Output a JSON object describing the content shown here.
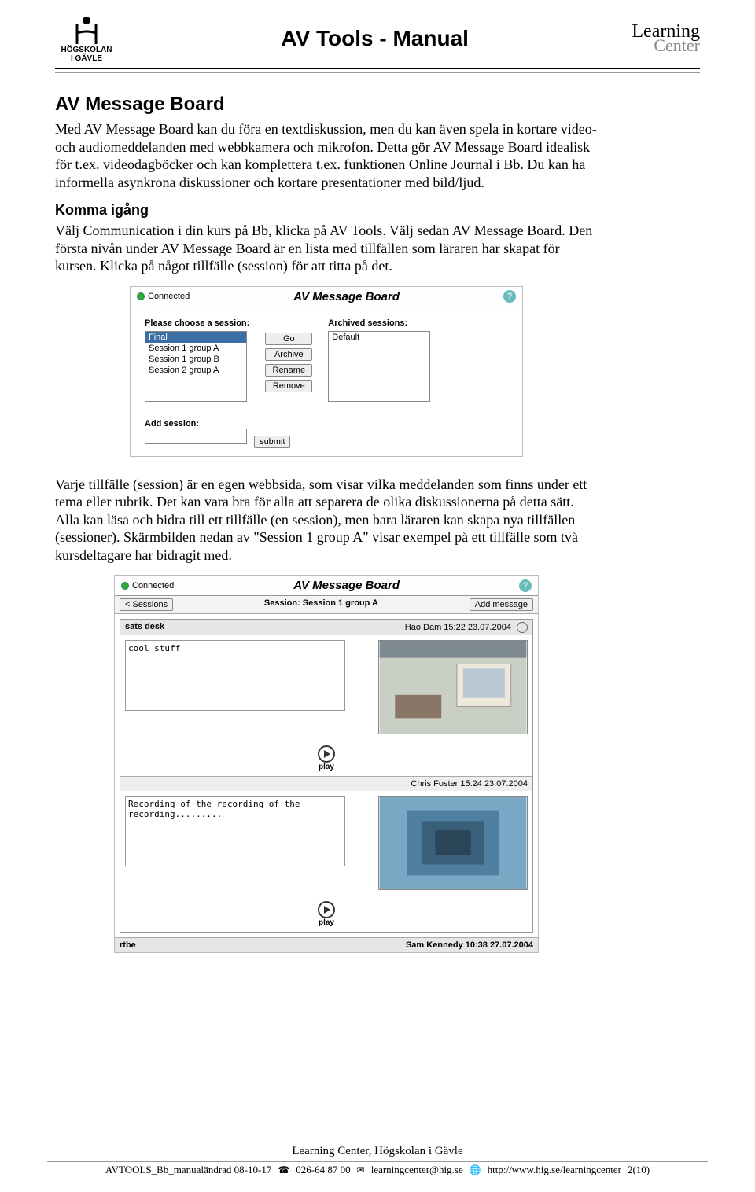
{
  "header": {
    "logo_line1": "HÖGSKOLAN",
    "logo_line2": "I GÄVLE",
    "title": "AV Tools - Manual",
    "right_line1": "Learning",
    "right_line2": "Center"
  },
  "section1": {
    "heading": "AV Message Board",
    "para": "Med AV Message Board kan du föra en textdiskussion, men du kan även spela in kortare video- och audiomeddelanden med webbkamera och mikrofon. Detta gör AV Message Board idealisk för t.ex. videodagböcker och kan komplettera t.ex. funktionen Online Journal i Bb. Du kan ha informella asynkrona diskussioner och kortare presentationer med bild/ljud."
  },
  "section2": {
    "heading": "Komma igång",
    "para": "Välj Communication i din kurs på Bb, klicka på AV Tools. Välj sedan AV Message Board. Den första nivån under AV Message Board är en lista med tillfällen som läraren har skapat för kursen. Klicka på något tillfälle (session) för att titta på det."
  },
  "shot1": {
    "connected": "Connected",
    "title": "AV Message Board",
    "choose_label": "Please choose a session:",
    "archived_label": "Archived sessions:",
    "sessions": [
      "Final",
      "Session 1 group A",
      "Session 1 group B",
      "Session 2 group A"
    ],
    "archived": [
      "Default"
    ],
    "buttons": {
      "go": "Go",
      "archive": "Archive",
      "rename": "Rename",
      "remove": "Remove"
    },
    "add_label": "Add session:",
    "submit": "submit"
  },
  "para2": "Varje tillfälle (session) är en egen webbsida, som visar vilka meddelanden som finns under ett tema eller rubrik. Det kan vara bra för alla att separera de olika diskussionerna på detta sätt. Alla kan läsa och bidra till ett tillfälle (en session), men bara läraren kan skapa nya tillfällen (sessioner). Skärmbilden nedan av \"Session 1 group A\" visar exempel på ett tillfälle som två kursdeltagare har bidragit med.",
  "shot2": {
    "connected": "Connected",
    "title": "AV Message Board",
    "back": "< Sessions",
    "session_label": "Session: Session 1  group A",
    "add_msg": "Add message",
    "msg1": {
      "topic": "sats desk",
      "meta": "Hao Dam 15:22 23.07.2004",
      "text": "cool stuff"
    },
    "play": "play",
    "mid_meta": "Chris Foster 15:24 23.07.2004",
    "msg2_text": "Recording of the recording of the recording.........",
    "bottom_left": "rtbe",
    "bottom_right": "Sam Kennedy 10:38 27.07.2004"
  },
  "footer": {
    "line1": "Learning Center, Högskolan i Gävle",
    "filename": "AVTOOLS_Bb_manualändrad 08-10-17",
    "phone": "026-64 87 00",
    "email": "learningcenter@hig.se",
    "url": "http://www.hig.se/learningcenter",
    "page": "2(10)"
  }
}
